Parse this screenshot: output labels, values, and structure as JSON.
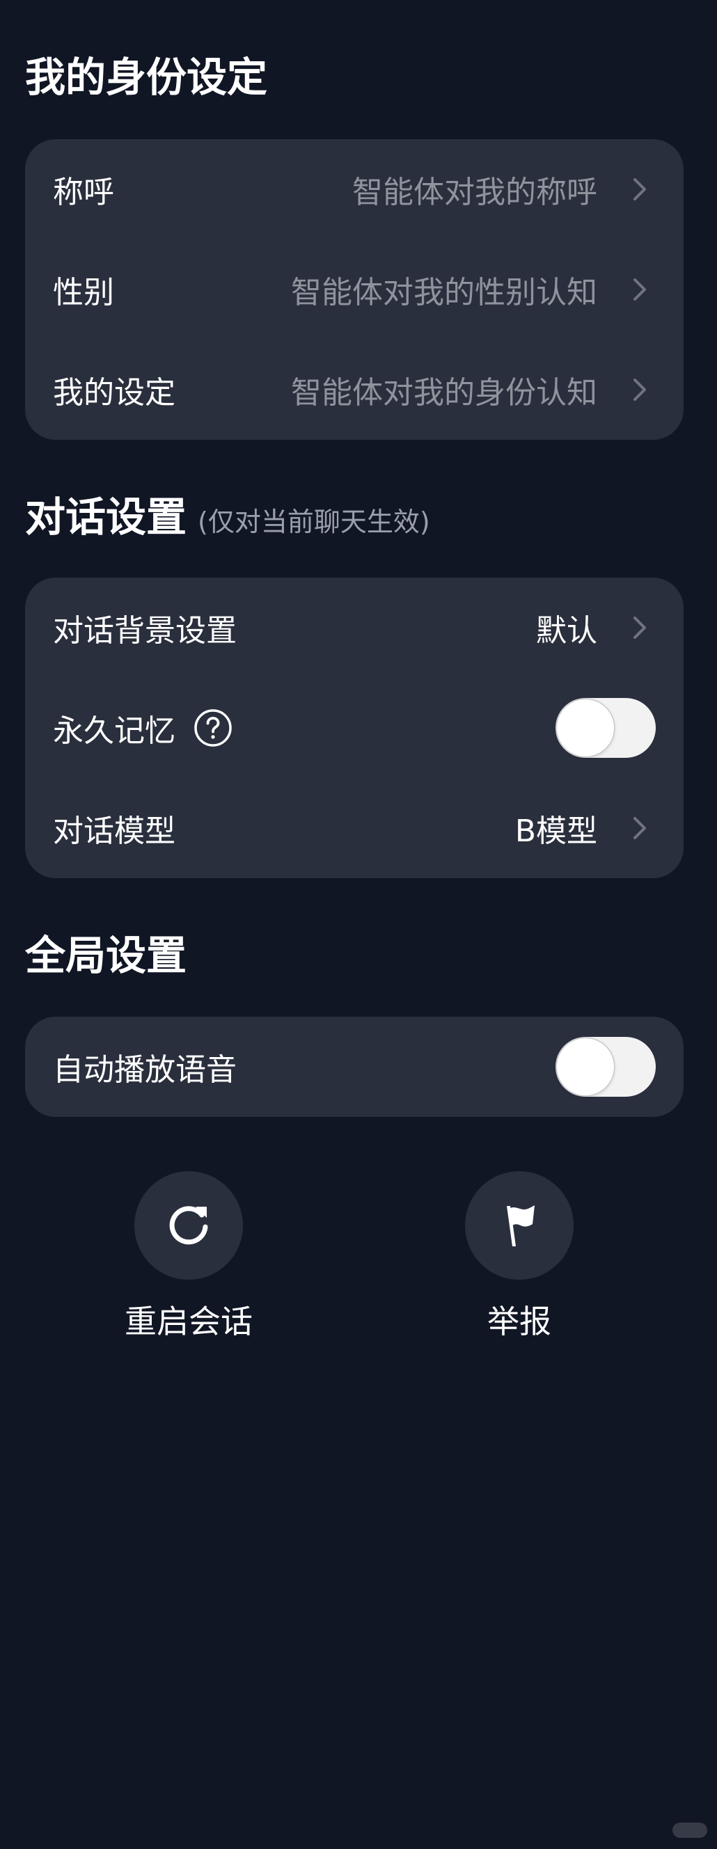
{
  "identity": {
    "title": "我的身份设定",
    "rows": [
      {
        "label": "称呼",
        "value": "智能体对我的称呼"
      },
      {
        "label": "性别",
        "value": "智能体对我的性别认知"
      },
      {
        "label": "我的设定",
        "value": "智能体对我的身份认知"
      }
    ]
  },
  "dialog": {
    "title": "对话设置",
    "subtitle": "(仅对当前聊天生效)",
    "background": {
      "label": "对话背景设置",
      "value": "默认"
    },
    "memory": {
      "label": "永久记忆",
      "enabled": false
    },
    "model": {
      "label": "对话模型",
      "value": "B模型"
    }
  },
  "global": {
    "title": "全局设置",
    "autoplay": {
      "label": "自动播放语音",
      "enabled": false
    }
  },
  "actions": {
    "restart_label": "重启会话",
    "report_label": "举报"
  },
  "icons": {
    "chevron": "chevron-right-icon",
    "help": "question-circle-icon",
    "restart": "refresh-icon",
    "report": "flag-icon"
  },
  "colors": {
    "background": "#111625",
    "card": "#2a2f3d",
    "secondary_text": "#8e939d",
    "toggle_off": "#f2f2f3"
  }
}
